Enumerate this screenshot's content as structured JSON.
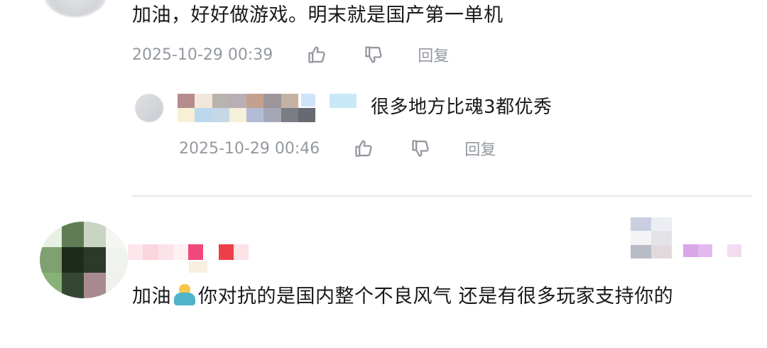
{
  "comments": [
    {
      "text": "加油，好好做游戏。明末就是国产第一单机",
      "time": "2025-10-29 00:39",
      "reply_label": "回复"
    },
    {
      "text": "很多地方比魂3都优秀",
      "time": "2025-10-29 00:46",
      "reply_label": "回复"
    },
    {
      "text_before_emoji": "加油",
      "text_after_emoji": "你对抗的是国内整个不良风气 还是有很多玩家支持你的"
    }
  ],
  "icons": {
    "like": "thumbs-up-icon",
    "dislike": "thumbs-down-icon",
    "emoji": "person-emoji-icon"
  },
  "colors": {
    "text": "#18191c",
    "meta": "#9499a0",
    "divider": "#e3e5e7"
  }
}
